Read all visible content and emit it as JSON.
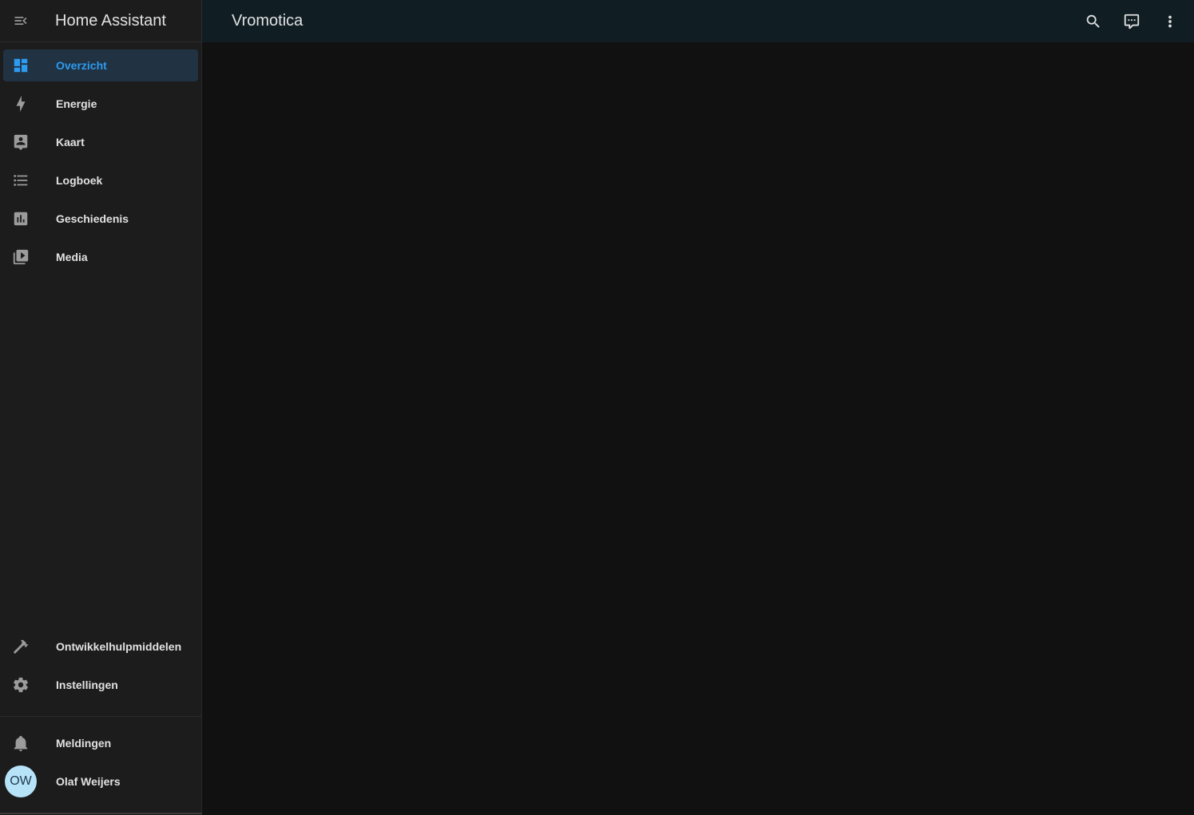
{
  "sidebar": {
    "title": "Home Assistant",
    "menu_icon": "menu-open-icon",
    "items": [
      {
        "label": "Overzicht",
        "icon": "dashboard-icon",
        "active": true
      },
      {
        "label": "Energie",
        "icon": "lightning-bolt-icon"
      },
      {
        "label": "Kaart",
        "icon": "map-account-icon"
      },
      {
        "label": "Logboek",
        "icon": "format-list-bulleted-icon"
      },
      {
        "label": "Geschiedenis",
        "icon": "chart-box-icon"
      },
      {
        "label": "Media",
        "icon": "play-box-multiple-icon"
      }
    ],
    "bottom_items": [
      {
        "label": "Ontwikkelhulpmiddelen",
        "icon": "hammer-icon"
      },
      {
        "label": "Instellingen",
        "icon": "cog-icon"
      }
    ],
    "notifications": {
      "label": "Meldingen",
      "icon": "bell-icon"
    },
    "user": {
      "initials": "OW",
      "name": "Olaf Weijers"
    }
  },
  "header": {
    "title": "Vromotica",
    "actions": [
      "search-icon",
      "comment-processing-icon",
      "dots-vertical-icon"
    ]
  },
  "colors": {
    "sidebar_bg": "#1c1c1c",
    "header_bg": "#101e24",
    "content_bg": "#111111",
    "accent": "#2d9bf0",
    "active_bg": "#213243",
    "text": "#e1e1e1",
    "icon": "#9b9b9b"
  }
}
